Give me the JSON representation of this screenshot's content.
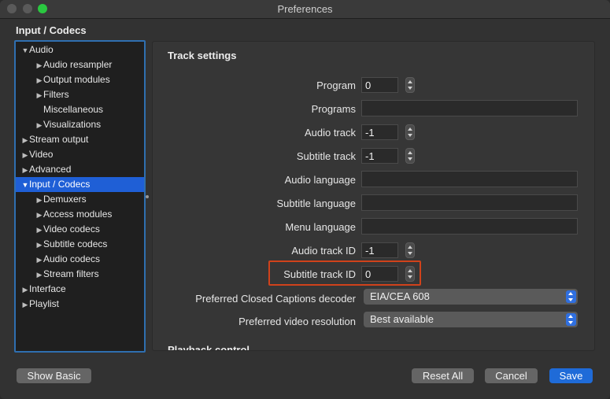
{
  "window": {
    "title": "Preferences"
  },
  "header": {
    "section_title": "Input / Codecs"
  },
  "sidebar": {
    "items": [
      {
        "label": "Audio",
        "arrow": "▼"
      },
      {
        "label": "Audio resampler",
        "arrow": "▶"
      },
      {
        "label": "Output modules",
        "arrow": "▶"
      },
      {
        "label": "Filters",
        "arrow": "▶"
      },
      {
        "label": "Miscellaneous",
        "arrow": ""
      },
      {
        "label": "Visualizations",
        "arrow": "▶"
      },
      {
        "label": "Stream output",
        "arrow": "▶"
      },
      {
        "label": "Video",
        "arrow": "▶"
      },
      {
        "label": "Advanced",
        "arrow": "▶"
      },
      {
        "label": "Input / Codecs",
        "arrow": "▼"
      },
      {
        "label": "Demuxers",
        "arrow": "▶"
      },
      {
        "label": "Access modules",
        "arrow": "▶"
      },
      {
        "label": "Video codecs",
        "arrow": "▶"
      },
      {
        "label": "Subtitle codecs",
        "arrow": "▶"
      },
      {
        "label": "Audio codecs",
        "arrow": "▶"
      },
      {
        "label": "Stream filters",
        "arrow": "▶"
      },
      {
        "label": "Interface",
        "arrow": "▶"
      },
      {
        "label": "Playlist",
        "arrow": "▶"
      }
    ]
  },
  "panel": {
    "heading": "Track settings",
    "program": {
      "label": "Program",
      "value": "0"
    },
    "programs": {
      "label": "Programs",
      "value": ""
    },
    "audio_track": {
      "label": "Audio track",
      "value": "-1"
    },
    "subtitle_track": {
      "label": "Subtitle track",
      "value": "-1"
    },
    "audio_language": {
      "label": "Audio language",
      "value": ""
    },
    "subtitle_language": {
      "label": "Subtitle language",
      "value": ""
    },
    "menu_language": {
      "label": "Menu language",
      "value": ""
    },
    "audio_track_id": {
      "label": "Audio track ID",
      "value": "-1"
    },
    "subtitle_track_id": {
      "label": "Subtitle track ID",
      "value": "0"
    },
    "cc_decoder": {
      "label": "Preferred Closed Captions decoder",
      "value": "EIA/CEA 608"
    },
    "video_resolution": {
      "label": "Preferred video resolution",
      "value": "Best available"
    },
    "next_heading": "Playback control"
  },
  "buttons": {
    "show_basic": "Show Basic",
    "reset_all": "Reset All",
    "cancel": "Cancel",
    "save": "Save"
  },
  "colors": {
    "accent": "#1f6bd8",
    "selection": "#1f5fd6",
    "highlight": "#d0421b"
  }
}
